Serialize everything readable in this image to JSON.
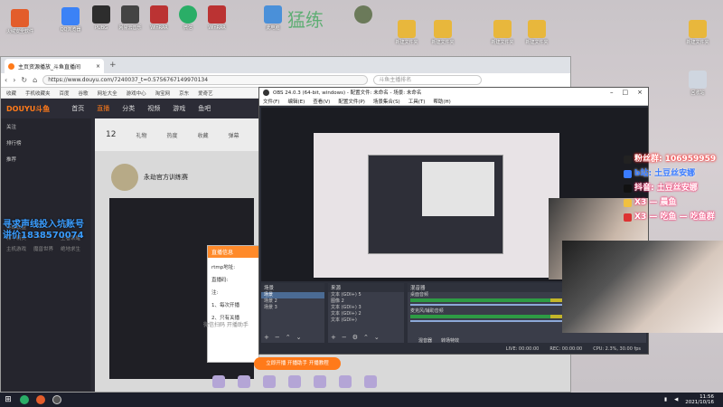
{
  "desktop": {
    "title": "猛练",
    "icons": [
      {
        "label": "火绒安全软件",
        "color": "#e35d2b"
      },
      {
        "label": "QQ浏览器",
        "color": "#3b82f6"
      },
      {
        "label": "PUBG",
        "color": "#2d2d2d"
      },
      {
        "label": "网易云音乐",
        "color": "#444"
      },
      {
        "label": "WinRAR",
        "color": "#b33"
      },
      {
        "label": "微信",
        "color": "#2aae67"
      },
      {
        "label": "WinRAR",
        "color": "#b33"
      },
      {
        "label": "此电脑",
        "color": "#4a90d9"
      },
      {
        "label": "新建文件夹",
        "color": "#e8b73c"
      },
      {
        "label": "新建文件夹",
        "color": "#e8b73c"
      },
      {
        "label": "新建文件夹",
        "color": "#e8b73c"
      },
      {
        "label": "新建文件夹",
        "color": "#e8b73c"
      },
      {
        "label": "新建文件夹",
        "color": "#e8b73c"
      },
      {
        "label": "回收站",
        "color": "#cfd6e0"
      }
    ]
  },
  "browser": {
    "tab_title": "主页资源播放_斗鱼直播间",
    "url": "https://www.douyu.com/7240037_t=0.5756767149970134",
    "search_placeholder": "斗鱼主播排名",
    "bookmarks": [
      "收藏",
      "手机收藏夹",
      "百度",
      "谷歌",
      "网址大全",
      "游戏中心",
      "淘宝网",
      "京东",
      "爱奇艺"
    ],
    "site_nav": [
      "首页",
      "直播",
      "分类",
      "视频",
      "游戏",
      "鱼吧"
    ],
    "sidebar_sections": [
      "关注",
      "排行榜",
      "推荐"
    ],
    "sidebar_grid": [
      "英雄联盟",
      "LPL",
      "DNF",
      "和平精英",
      "CS:GO",
      "王者荣耀",
      "主机游戏",
      "魔兽世界",
      "绝地求生"
    ],
    "overlay_lines": [
      "寻求声线投入坑账号",
      "讲价1838570074"
    ],
    "room_bar": [
      "12",
      "礼物",
      "热度",
      "收藏",
      "弹幕",
      "分享"
    ],
    "room_title": "永劫官方训练赛",
    "dialog": {
      "title": "直播信息",
      "rows": [
        "rtmp地址:",
        "直播码:",
        "注:",
        "1、每次开播",
        "2、只有关播"
      ]
    },
    "bottom_link": "微信扫码 开播助手",
    "cta": "立即开播 开播助手 开播教程"
  },
  "obs": {
    "title": "OBS 24.0.3 (64-bit, windows) - 配置文件: 未命名 - 场景: 未命名",
    "menu": [
      "文件(F)",
      "编辑(E)",
      "查看(V)",
      "配置文件(P)",
      "场景集合(S)",
      "工具(T)",
      "帮助(H)"
    ],
    "scenes_header": "场景",
    "scenes": [
      "场景",
      "场景 2",
      "场景 3"
    ],
    "sources_header": "来源",
    "sources": [
      "文本 (GDI+) 5",
      "图像 2",
      "文本 (GDI+) 3",
      "文本 (GDI+) 2",
      "文本 (GDI+)"
    ],
    "mixer_header": "混音器",
    "mixer": [
      "桌面音频",
      "麦克风/辅助音频"
    ],
    "tabs": [
      "混音器",
      "转场特效"
    ],
    "status": [
      "LIVE: 00:00:00",
      "REC: 00:00:00",
      "CPU: 2.3%, 30.00 fps"
    ]
  },
  "overlay": {
    "social": [
      "粉丝群: 106959959",
      "b站: 土豆丝安娜",
      "抖音: 土豆丝安娜",
      "X3 — 晨鱼",
      "X3 — 吃鱼 — 吃鱼群"
    ]
  },
  "taskbar": {
    "time": "11:56",
    "date": "2021/10/16"
  }
}
